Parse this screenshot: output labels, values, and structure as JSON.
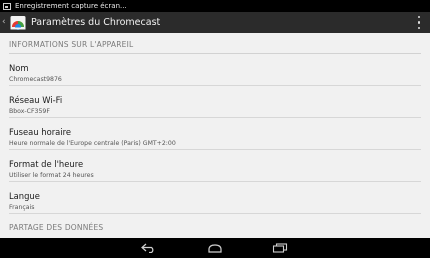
{
  "status_bar": {
    "notification_text": "Enregistrement capture écran..."
  },
  "action_bar": {
    "title": "Paramètres du Chromecast"
  },
  "sections": [
    {
      "header": "INFORMATIONS SUR L'APPAREIL"
    },
    {
      "header": "PARTAGE DES DONNÉES"
    }
  ],
  "prefs": [
    {
      "title": "Nom",
      "summary": "Chromecast9876"
    },
    {
      "title": "Réseau Wi-Fi",
      "summary": "Bbox-CF359F"
    },
    {
      "title": "Fuseau horaire",
      "summary": "Heure normale de l'Europe centrale (Paris) GMT+2:00"
    },
    {
      "title": "Format de l'heure",
      "summary": "Utiliser le format 24 heures"
    },
    {
      "title": "Langue",
      "summary": "Français"
    }
  ],
  "colors": {
    "status_bar": "#000000",
    "action_bar": "#2b2b2b",
    "content_bg": "#f1f1f1",
    "nav_bar": "#000000"
  },
  "icons": [
    "screenshot-notification-icon",
    "up-chevron-icon",
    "chromecast-app-icon",
    "overflow-menu-icon",
    "back-icon",
    "home-icon",
    "recent-apps-icon"
  ]
}
